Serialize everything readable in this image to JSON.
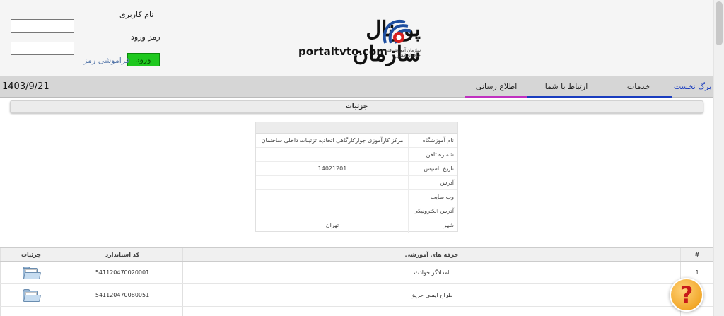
{
  "login": {
    "username_label": "نام کاربری",
    "password_label": "رمز ورود",
    "username_value": "",
    "password_value": "",
    "login_button": "ورود",
    "forgot_link": "فراموشی رمز"
  },
  "logo": {
    "title": "پورتال سازمان",
    "url": "portaltvto.com",
    "subtitle": "سازمان آموزش فنی و حرفه‌ای کشور"
  },
  "nav": {
    "date": "1403/9/21",
    "items": [
      {
        "label": "برگ نخست",
        "accent": "#1a3dbf"
      },
      {
        "label": "خدمات",
        "accent": "#1a3dbf"
      },
      {
        "label": "ارتباط با شما",
        "accent": "#1a3dbf"
      },
      {
        "label": "اطلاع رسانی",
        "accent": "#c030c0"
      }
    ]
  },
  "details": {
    "title": "جزئیات",
    "rows": [
      {
        "label": "نام آموزشگاه",
        "value": "مرکز کارآموزی جوارکارگاهی اتحادیه تزئینات داخلی ساختمان"
      },
      {
        "label": "شماره تلفن",
        "value": ""
      },
      {
        "label": "تاریخ تاسیس",
        "value": "14021201"
      },
      {
        "label": "آدرس",
        "value": ""
      },
      {
        "label": "وب سایت",
        "value": ""
      },
      {
        "label": "آدرس الکترونیکی",
        "value": ""
      },
      {
        "label": "شهر",
        "value": "تهران"
      }
    ]
  },
  "table": {
    "columns": {
      "num": "#",
      "trade": "حرفه های آموزشی",
      "code": "کد استاندارد",
      "details": "جزئیات"
    },
    "rows": [
      {
        "num": "1",
        "trade": "امدادگر حوادث",
        "code": "541120470020001"
      },
      {
        "num": "",
        "trade": "طراح ایمنی حریق",
        "code": "541120470080051"
      }
    ]
  },
  "icons": {
    "details_icon": "folder-icon",
    "help_icon": "question-icon"
  },
  "colors": {
    "login_button": "#1ec81e",
    "nav_bar": "#d6d6d6",
    "help_badge": "#f2a82a",
    "help_mark": "#c81a1a"
  }
}
